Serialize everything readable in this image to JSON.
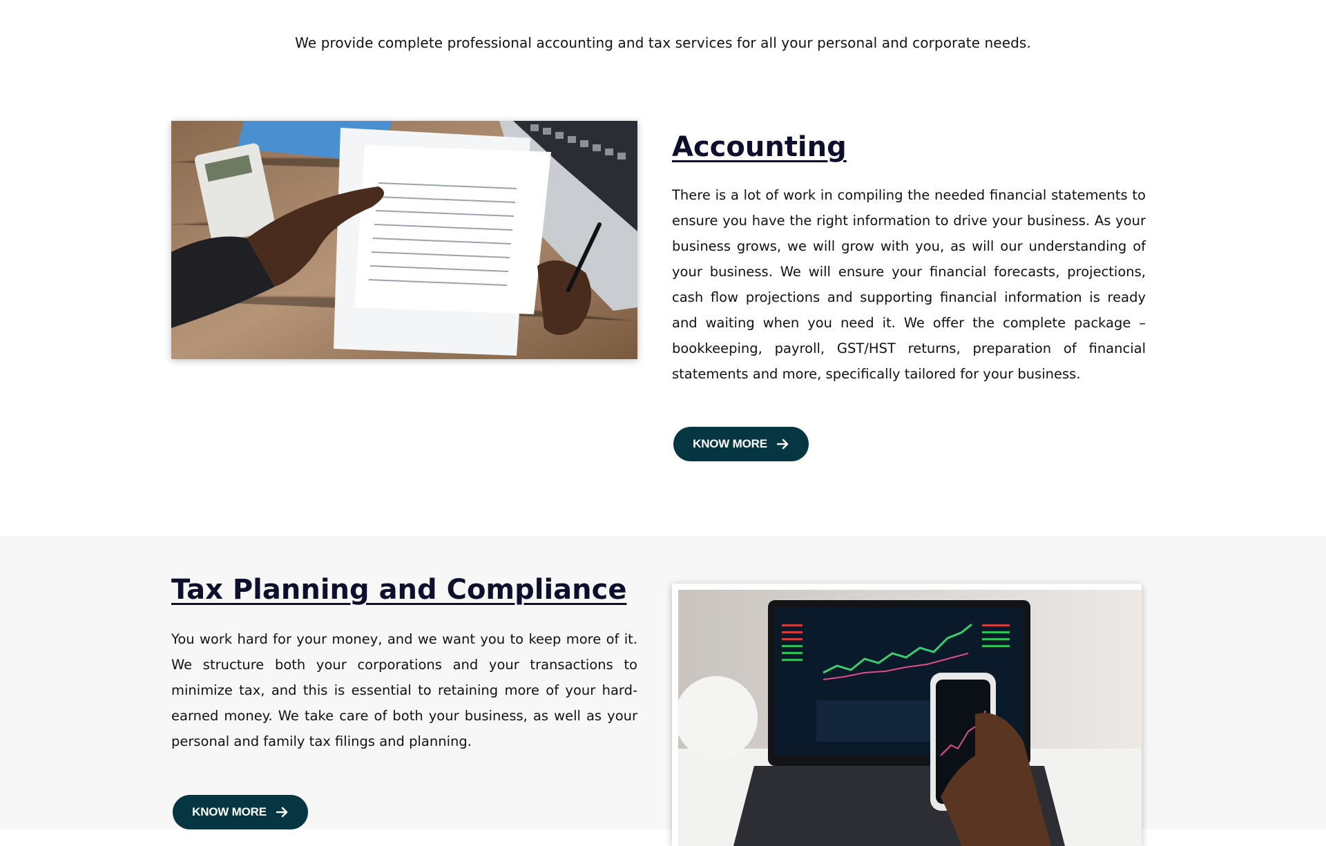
{
  "intro": {
    "text": "We provide complete professional accounting and tax services for all your personal and corporate needs."
  },
  "accounting": {
    "title": "Accounting",
    "body": "There is a lot of work in compiling the needed financial statements to ensure you have the right information to drive your business. As your business grows, we will grow with you, as will our understanding of your business. We will ensure your financial forecasts, projections, cash flow projections and supporting financial information is ready and waiting when you need it. We offer the complete package – bookkeeping, payroll, GST/HST returns, preparation of financial statements and more, specifically tailored for your business.",
    "button_label": "KNOW MORE",
    "button_icon": "arrow-right-icon"
  },
  "tax": {
    "title": "Tax Planning and Compliance",
    "body": "You work hard for your money, and we want you to keep more of it. We structure both your corporations and your transactions to minimize tax, and this is essential to retaining more of your hard-earned money. We take care of both your business, as well as your personal and family tax filings and planning.",
    "button_label": "KNOW MORE",
    "button_icon": "arrow-right-icon"
  },
  "colors": {
    "button_bg": "#063642",
    "heading": "#0e0f2c",
    "alt_section_bg": "#f7f7f7"
  }
}
